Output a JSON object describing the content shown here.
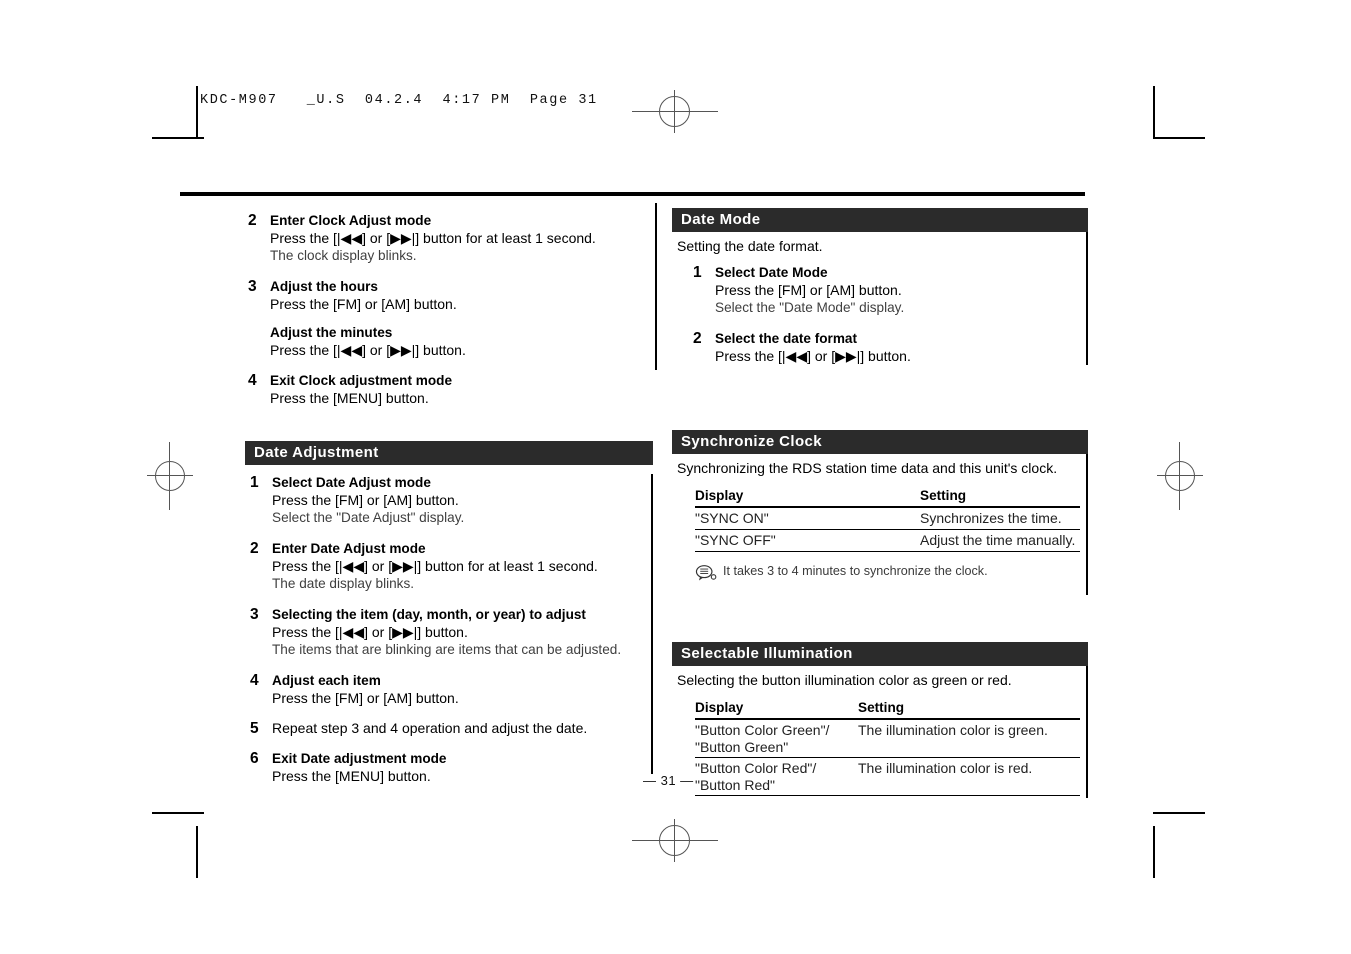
{
  "slug": "KDC-M907   _U.S  04.2.4  4:17 PM  Page 31",
  "page_number": "— 31 —",
  "colors": {
    "title_bar": "#2b2b2b",
    "text": "#000000",
    "muted": "#3f3f3f"
  },
  "glyphs": {
    "rewind": "[|◀◀]",
    "forward": "[▶▶|]"
  },
  "left_column": {
    "clock_steps": {
      "name": "clock-adjust-steps",
      "steps": [
        {
          "num": "2",
          "head": "Enter Clock Adjust mode",
          "sub": "Press the [|◀◀] or [▶▶|] button for at least 1 second.",
          "note": "The clock display blinks."
        },
        {
          "num": "3",
          "head": "Adjust the hours",
          "sub": "Press the [FM] or [AM] button.",
          "head2": "Adjust the minutes",
          "sub2": "Press the [|◀◀] or [▶▶|] button."
        },
        {
          "num": "4",
          "head": "Exit Clock adjustment mode",
          "sub": "Press the [MENU] button."
        }
      ]
    },
    "date_adjustment": {
      "title": "Date Adjustment",
      "steps": [
        {
          "num": "1",
          "head": "Select Date Adjust mode",
          "sub": "Press the [FM] or [AM] button.",
          "note": "Select the \"Date Adjust\" display."
        },
        {
          "num": "2",
          "head": "Enter Date Adjust mode",
          "sub": "Press the [|◀◀] or [▶▶|] button for at least 1 second.",
          "note": "The date display blinks."
        },
        {
          "num": "3",
          "head": "Selecting the item (day, month, or year) to adjust",
          "sub": "Press the [|◀◀] or [▶▶|] button.",
          "note": "The items that are blinking are items that can be adjusted."
        },
        {
          "num": "4",
          "head": "Adjust each item",
          "sub": "Press the [FM] or [AM] button."
        },
        {
          "num": "5",
          "head": "Repeat step 3 and 4 operation and adjust the date.",
          "plain": true
        },
        {
          "num": "6",
          "head": "Exit Date adjustment mode",
          "sub": "Press the [MENU] button."
        }
      ]
    }
  },
  "right_column": {
    "date_mode": {
      "title": "Date Mode",
      "lead": "Setting the date format.",
      "steps": [
        {
          "num": "1",
          "head": "Select Date Mode",
          "sub": "Press the [FM] or [AM] button.",
          "note": "Select the \"Date Mode\" display."
        },
        {
          "num": "2",
          "head": "Select the date format",
          "sub": "Press the [|◀◀] or [▶▶|] button."
        }
      ]
    },
    "synchronize_clock": {
      "title": "Synchronize Clock",
      "lead": "Synchronizing the RDS station time data and this unit's clock.",
      "table": {
        "headers": [
          "Display",
          "Setting"
        ],
        "rows": [
          [
            "\"SYNC ON\"",
            "Synchronizes the time."
          ],
          [
            "\"SYNC OFF\"",
            "Adjust the time manually."
          ]
        ]
      },
      "note": "It takes 3 to 4 minutes to synchronize the clock.",
      "note_icon": "note-bubble-icon"
    },
    "selectable_illumination": {
      "title": "Selectable Illumination",
      "lead": "Selecting the button illumination color as green or red.",
      "table": {
        "headers": [
          "Display",
          "Setting"
        ],
        "rows": [
          [
            "\"Button Color Green\"/\n\"Button Green\"",
            "The illumination color is green."
          ],
          [
            "\"Button Color Red\"/\n\"Button Red\"",
            "The illumination color is red."
          ]
        ]
      }
    }
  }
}
